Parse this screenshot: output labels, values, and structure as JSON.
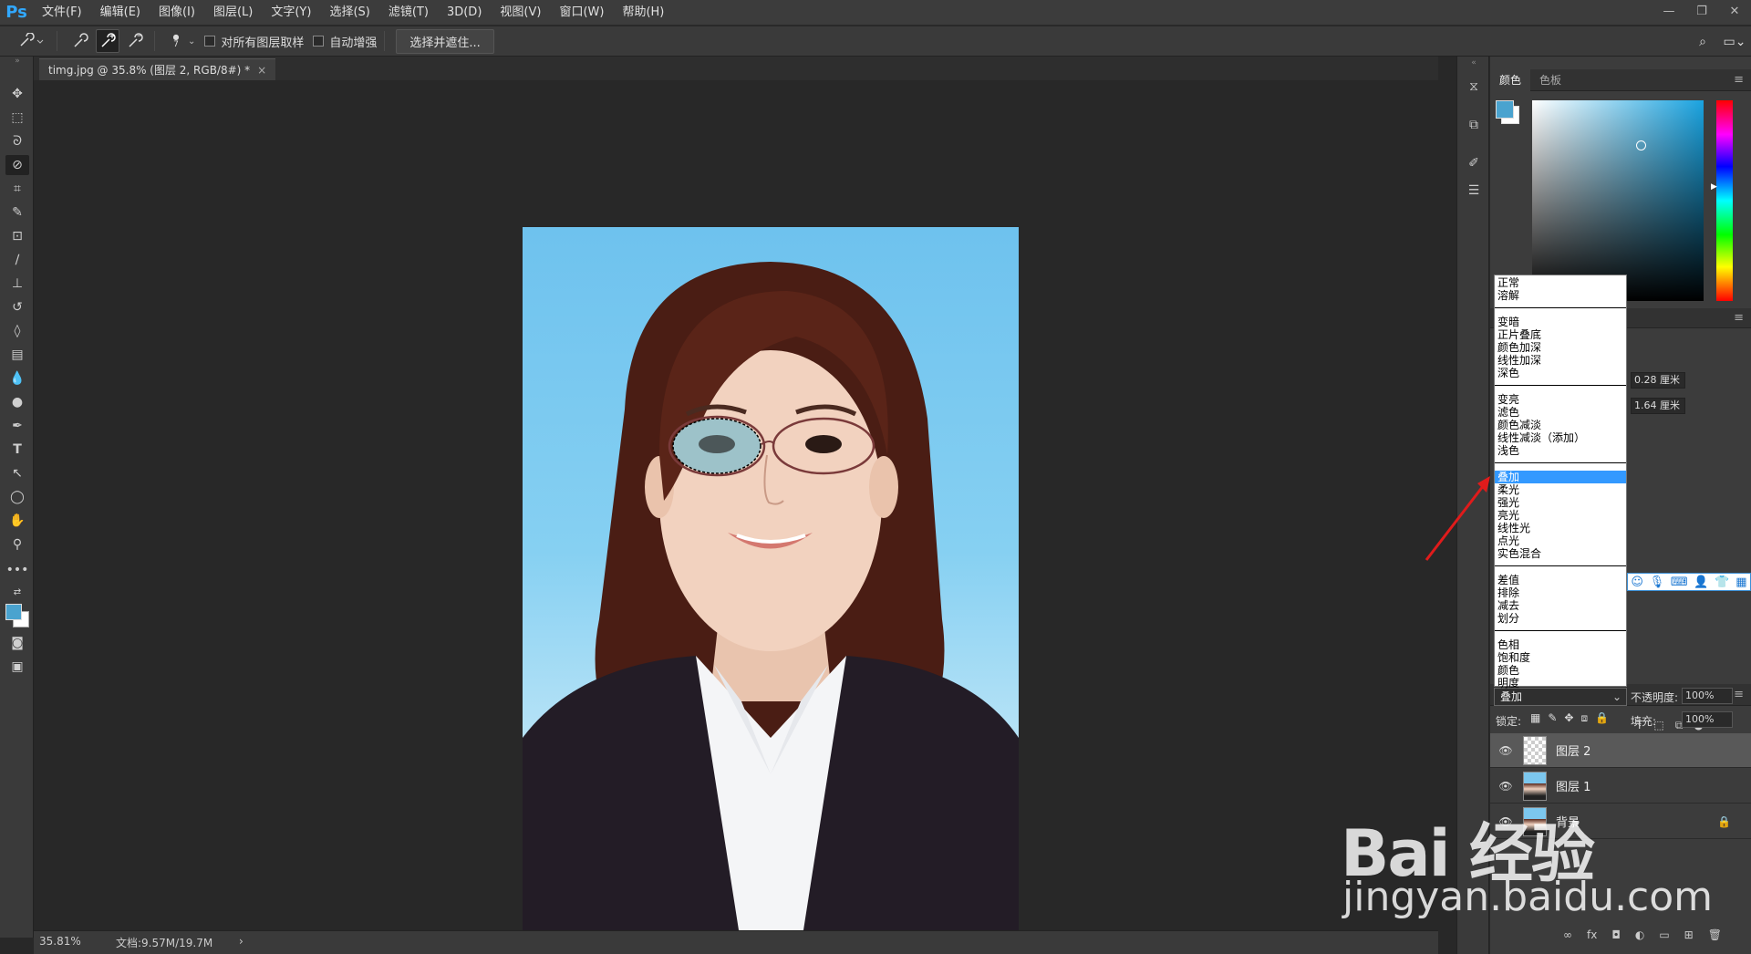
{
  "app": {
    "logo": "Ps"
  },
  "menu": [
    "文件(F)",
    "编辑(E)",
    "图像(I)",
    "图层(L)",
    "文字(Y)",
    "选择(S)",
    "滤镜(T)",
    "3D(D)",
    "视图(V)",
    "窗口(W)",
    "帮助(H)"
  ],
  "window_controls": {
    "minimize": "—",
    "restore": "❐",
    "close": "✕"
  },
  "options": {
    "brush_size": "7",
    "sample_all_layers": "对所有图层取样",
    "auto_enhance": "自动增强",
    "select_and_mask": "选择并遮住..."
  },
  "document": {
    "tab_title": "timg.jpg @ 35.8% (图层 2, RGB/8#) *",
    "close": "×"
  },
  "status": {
    "zoom": "35.81%",
    "doc_info": "文档:9.57M/19.7M",
    "arrow": "›"
  },
  "color_panel": {
    "tabs": [
      "颜色",
      "色板"
    ],
    "foreground": "#4aa3cf",
    "background": "#ffffff",
    "field_hue": "#1aa3e0"
  },
  "properties": {
    "value1": "0.28 厘米",
    "value2": "1.64 厘米"
  },
  "blend_modes": {
    "groups": [
      [
        "正常",
        "溶解"
      ],
      [
        "变暗",
        "正片叠底",
        "颜色加深",
        "线性加深",
        "深色"
      ],
      [
        "变亮",
        "滤色",
        "颜色减淡",
        "线性减淡（添加）",
        "浅色"
      ],
      [
        "叠加",
        "柔光",
        "强光",
        "亮光",
        "线性光",
        "点光",
        "实色混合"
      ],
      [
        "差值",
        "排除",
        "减去",
        "划分"
      ],
      [
        "色相",
        "饱和度",
        "颜色",
        "明度"
      ]
    ],
    "selected": "叠加"
  },
  "layers": {
    "blend_select": "叠加",
    "opacity_label": "不透明度:",
    "opacity_value": "100%",
    "lock_label": "锁定:",
    "fill_label": "填充:",
    "fill_value": "100%",
    "items": [
      {
        "name": "图层 2",
        "selected": true
      },
      {
        "name": "图层 1",
        "selected": false
      },
      {
        "name": "背景",
        "selected": false
      }
    ]
  },
  "watermark": {
    "logo": "Bai 经验",
    "url": "jingyan.baidu.com"
  }
}
